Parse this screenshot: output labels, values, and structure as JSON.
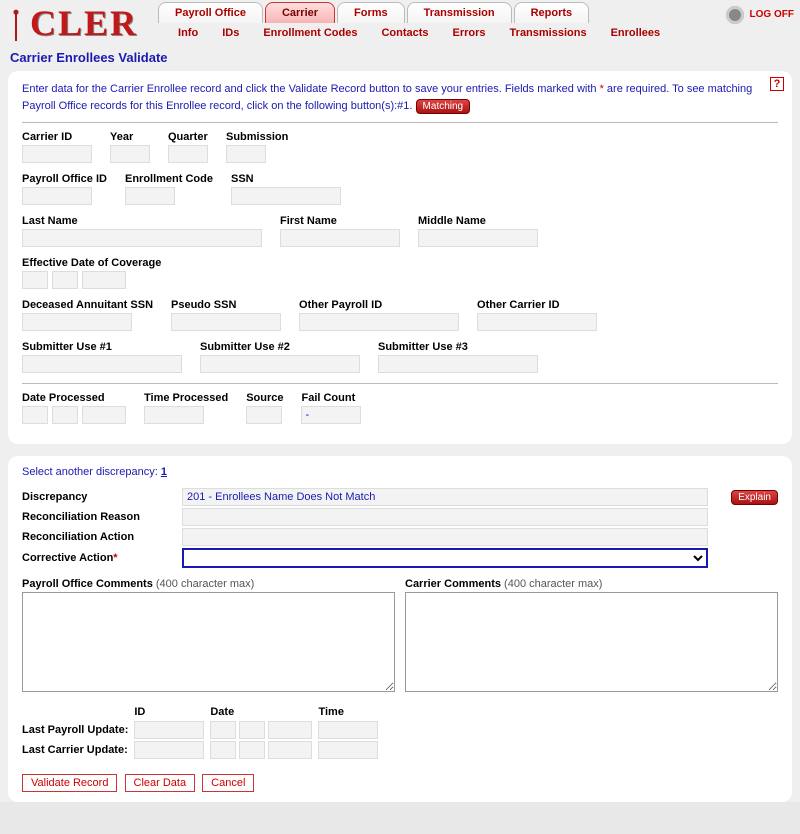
{
  "app": {
    "logo_text": "CLER"
  },
  "main_tabs": [
    "Payroll Office",
    "Carrier",
    "Forms",
    "Transmission",
    "Reports"
  ],
  "main_tab_active": 1,
  "sub_tabs": [
    "Info",
    "IDs",
    "Enrollment Codes",
    "Contacts",
    "Errors",
    "Transmissions",
    "Enrollees"
  ],
  "logoff": "LOG OFF",
  "page_title": "Carrier Enrollees Validate",
  "instructions": {
    "l1a": "Enter data for the Carrier Enrollee record and click the Validate Record button to save your entries.  Fields marked with ",
    "l1b": " are required.   To see matching Payroll Office records for this Enrollee record, click on the following button(s):#1.",
    "star": "*",
    "matching_btn": "Matching"
  },
  "fields": {
    "carrier_id": "Carrier ID",
    "year": "Year",
    "quarter": "Quarter",
    "submission": "Submission",
    "payroll_office_id": "Payroll Office ID",
    "enrollment_code": "Enrollment Code",
    "ssn": "SSN",
    "last_name": "Last Name",
    "first_name": "First Name",
    "middle_name": "Middle Name",
    "eff_date": "Effective Date of Coverage",
    "dec_ann_ssn": "Deceased Annuitant SSN",
    "pseudo_ssn": "Pseudo SSN",
    "other_payroll_id": "Other Payroll ID",
    "other_carrier_id": "Other Carrier ID",
    "sub_use_1": "Submitter Use #1",
    "sub_use_2": "Submitter Use #2",
    "sub_use_3": "Submitter Use #3",
    "date_processed": "Date Processed",
    "time_processed": "Time Processed",
    "source": "Source",
    "fail_count": "Fail Count"
  },
  "panel2": {
    "select_label": "Select another discrepancy:",
    "select_num": "1",
    "discrepancy_label": "Discrepancy",
    "discrepancy_value": "201 - Enrollees Name Does Not Match",
    "rec_reason_label": "Reconciliation Reason",
    "rec_action_label": "Reconciliation Action",
    "corrective_label": "Corrective Action",
    "explain_btn": "Explain",
    "po_comments_label": "Payroll Office Comments",
    "carrier_comments_label": "Carrier Comments",
    "char_max": " (400 character max)",
    "id": "ID",
    "date": "Date",
    "time": "Time",
    "last_po_update": "Last Payroll Update:",
    "last_carrier_update": "Last Carrier Update:"
  },
  "actions": {
    "validate": "Validate Record",
    "clear": "Clear Data",
    "cancel": "Cancel"
  },
  "values": {
    "fail_count": "-"
  }
}
